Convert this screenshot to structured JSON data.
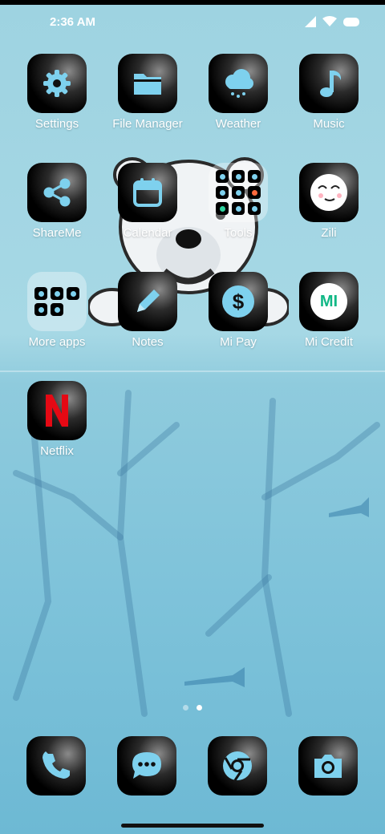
{
  "status_bar": {
    "time": "2:36 AM"
  },
  "apps": [
    {
      "label": "Settings",
      "icon": "gear-icon"
    },
    {
      "label": "File Manager",
      "icon": "folder-icon"
    },
    {
      "label": "Weather",
      "icon": "cloud-rain-icon"
    },
    {
      "label": "Music",
      "icon": "music-note-icon"
    },
    {
      "label": "ShareMe",
      "icon": "share-icon"
    },
    {
      "label": "Calendar",
      "icon": "calendar-icon"
    },
    {
      "label": "Tools",
      "icon": "folder-grid-icon"
    },
    {
      "label": "Zili",
      "icon": "smiley-face-icon"
    },
    {
      "label": "More apps",
      "icon": "folder-grid-icon"
    },
    {
      "label": "Notes",
      "icon": "pencil-icon"
    },
    {
      "label": "Mi Pay",
      "icon": "dollar-icon"
    },
    {
      "label": "Mi Credit",
      "icon": "mi-credit-logo"
    },
    {
      "label": "Netflix",
      "icon": "netflix-icon"
    }
  ],
  "mi_credit_logo_text": "MI",
  "dock": [
    {
      "label": "Phone",
      "icon": "phone-icon"
    },
    {
      "label": "Messaging",
      "icon": "chat-icon"
    },
    {
      "label": "Chrome",
      "icon": "chrome-icon"
    },
    {
      "label": "Camera",
      "icon": "camera-icon"
    }
  ],
  "pager": {
    "pages": 2,
    "current": 2
  },
  "colors": {
    "accent": "#7ed1ee",
    "netflix_red": "#e50914"
  }
}
